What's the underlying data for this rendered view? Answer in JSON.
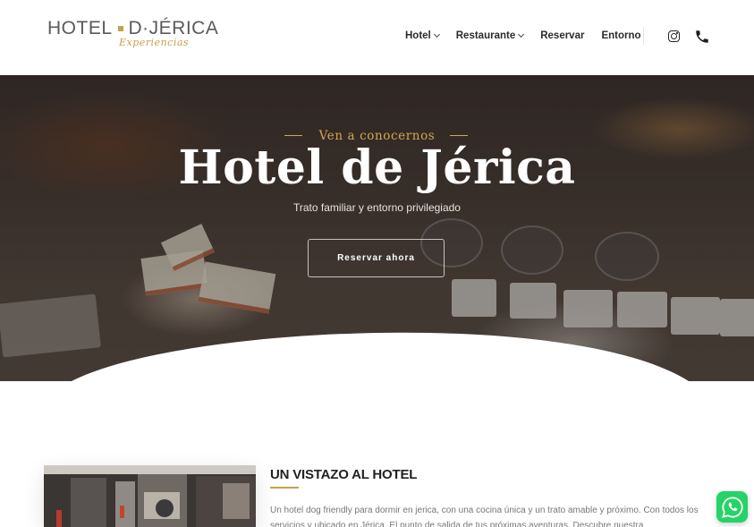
{
  "brand": {
    "name_left": "HOTEL",
    "name_right": "D·JÉRICA",
    "tagline": "Experiencias",
    "accent": "#c7a04b"
  },
  "nav": {
    "items": [
      {
        "label": "Hotel",
        "has_dropdown": true
      },
      {
        "label": "Restaurante",
        "has_dropdown": true
      },
      {
        "label": "Reservar",
        "has_dropdown": false
      },
      {
        "label": "Entorno",
        "has_dropdown": false
      }
    ],
    "icons": [
      "instagram-icon",
      "phone-icon"
    ]
  },
  "hero": {
    "eyebrow": "Ven a conocernos",
    "title": "Hotel de Jérica",
    "subtitle": "Trato familiar y entorno privilegiado",
    "cta_label": "Reservar ahora",
    "eyebrow_color": "#d1a94f"
  },
  "about": {
    "title": "UN VISTAZO AL HOTEL",
    "paragraph": "Un hotel dog friendly para dormir en jerica, con una cocina única y un trato amable y próximo. Con todos los servicios y ubicado en Jérica. El punto de salida de tus próximas aventuras. Descubre nuestra"
  },
  "whatsapp": {
    "icon": "whatsapp-icon",
    "color": "#25d366"
  }
}
